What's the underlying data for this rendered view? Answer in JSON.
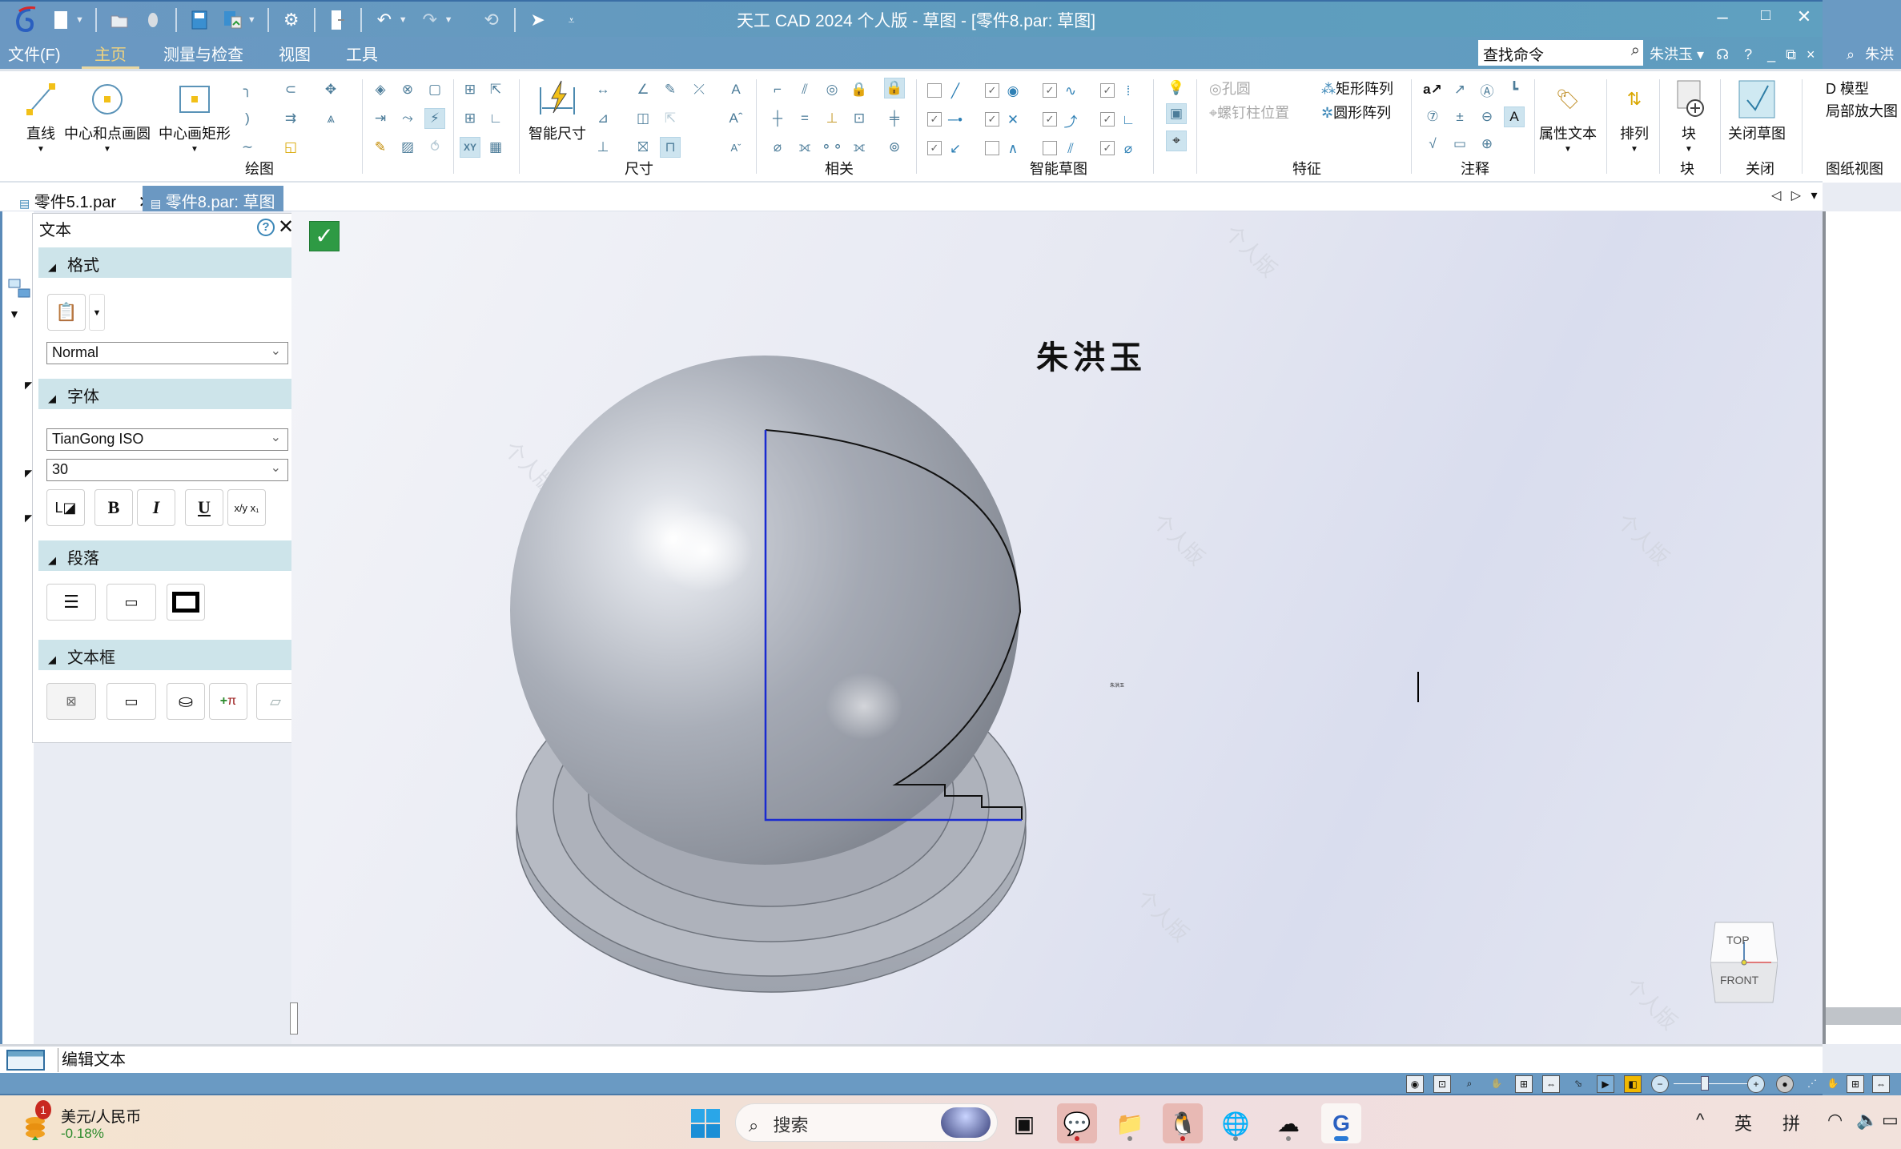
{
  "window": {
    "title": "天工 CAD 2024 个人版 - 草图 - [零件8.par: 草图]",
    "controls": {
      "minimize": "–",
      "maximize": "□",
      "close": "✕"
    }
  },
  "quick_access": [
    {
      "name": "new-file-icon",
      "glyph": "▯"
    },
    {
      "name": "open-file-icon",
      "glyph": "📂"
    },
    {
      "name": "save-icon",
      "glyph": "💾"
    },
    {
      "name": "save-as-icon",
      "glyph": "⎘"
    },
    {
      "name": "settings-icon",
      "glyph": "⚙"
    },
    {
      "name": "exit-icon",
      "glyph": "⇥"
    },
    {
      "name": "undo-icon",
      "glyph": "↶"
    },
    {
      "name": "redo-icon",
      "glyph": "↷"
    },
    {
      "name": "repeat-icon",
      "glyph": "⟲"
    },
    {
      "name": "select-icon",
      "glyph": "➤"
    },
    {
      "name": "customize-icon",
      "glyph": "⩡"
    }
  ],
  "menu": {
    "items": [
      "文件(F)",
      "主页",
      "测量与检查",
      "视图",
      "工具"
    ],
    "active": "主页",
    "search_placeholder": "查找命令",
    "user": "朱洪玉 ▾",
    "help": "?",
    "right_overflow_user": "朱洪"
  },
  "ribbon": {
    "draw": {
      "label": "绘图",
      "big_buttons": [
        "直线",
        "中心和点画圆",
        "中心画矩形"
      ]
    },
    "dimension": {
      "label": "尺寸",
      "big_button": "智能尺寸"
    },
    "relate": {
      "label": "相关"
    },
    "smart_sketch": {
      "label": "智能草图",
      "checks": [
        false,
        true,
        true,
        true,
        true,
        true,
        true,
        true,
        true,
        false,
        false,
        true
      ]
    },
    "feature": {
      "label": "特征",
      "items": [
        "孔圆",
        "螺钉柱位置",
        "矩形阵列",
        "圆形阵列"
      ]
    },
    "annotation": {
      "label": "注释"
    },
    "attr_text": "属性文本",
    "arrange": "排列",
    "block": {
      "button": "块",
      "label": "块"
    },
    "close": {
      "button": "关闭草图",
      "label": "关闭"
    },
    "overflow": [
      "D 模型",
      "局部放大图",
      "图纸视图"
    ]
  },
  "doc_tabs": [
    {
      "label": "零件5.1.par",
      "active": false,
      "closable": true
    },
    {
      "label": "零件8.par: 草图",
      "active": true,
      "closable": false
    }
  ],
  "tab_nav": {
    "prev": "◁",
    "next": "▷",
    "menu": "▾"
  },
  "text_panel": {
    "title": "文本",
    "sections": {
      "format": {
        "label": "格式",
        "style_value": "Normal"
      },
      "font": {
        "label": "字体",
        "font_value": "TianGong ISO",
        "size_value": "30",
        "buttons": [
          "B",
          "I",
          "U"
        ]
      },
      "paragraph": {
        "label": "段落"
      },
      "textbox": {
        "label": "文本框"
      }
    }
  },
  "canvas": {
    "sketch_text": "朱洪玉",
    "small_mark": "朱洪玉",
    "watermark": "个人版",
    "confirm": "✓",
    "viewcube": {
      "top": "TOP",
      "front": "FRONT"
    }
  },
  "command_line": {
    "text": "编辑文本"
  },
  "taskbar": {
    "widget": {
      "title": "美元/人民币",
      "change": "-0.18%",
      "badge": "1"
    },
    "search_placeholder": "搜索",
    "apps": [
      {
        "name": "task-view",
        "glyph": "▣",
        "highlight": false,
        "dot": false
      },
      {
        "name": "wechat",
        "glyph": "💬",
        "highlight": true,
        "dot": "red"
      },
      {
        "name": "file-explorer",
        "glyph": "📁",
        "highlight": false,
        "dot": "gray"
      },
      {
        "name": "qq",
        "glyph": "🐧",
        "highlight": true,
        "dot": "red"
      },
      {
        "name": "edge",
        "glyph": "🌐",
        "highlight": false,
        "dot": "gray"
      },
      {
        "name": "baidu-netdisk",
        "glyph": "☁",
        "highlight": false,
        "dot": "gray"
      },
      {
        "name": "tiangong-cad",
        "glyph": "G",
        "highlight": false,
        "dot": "active"
      }
    ],
    "tray": {
      "overflow": "^",
      "lang1": "英",
      "lang2": "拼"
    }
  },
  "colors": {
    "title_blue": "#6b98c2",
    "section_header": "#cde4ea",
    "active_tab_text": "#f1d37e",
    "sketch_line_blue": "#1a2bd0",
    "confirm_green": "#2e9a44"
  }
}
